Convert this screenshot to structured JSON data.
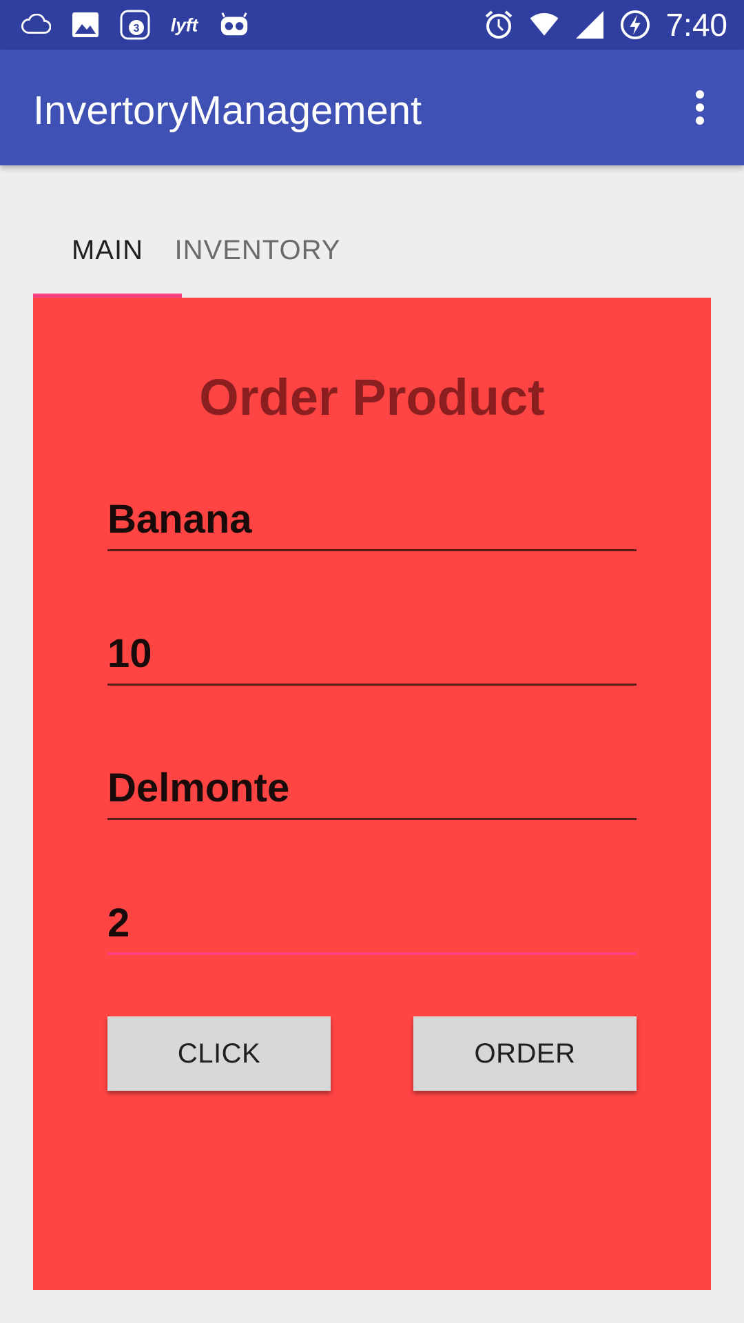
{
  "status_bar": {
    "time": "7:40",
    "icons": [
      "cloud-icon",
      "image-icon",
      "badge-3-icon",
      "lyft-icon",
      "robot-icon",
      "alarm-icon",
      "wifi-icon",
      "signal-icon",
      "battery-charging-icon"
    ],
    "badge_count": "3",
    "lyft_label": "lyft"
  },
  "app_bar": {
    "title": "InvertoryManagement",
    "menu_icon": "more-vert-icon"
  },
  "tabs": [
    {
      "label": "MAIN",
      "selected": true
    },
    {
      "label": "INVENTORY",
      "selected": false
    }
  ],
  "colors": {
    "status_bar": "#303f9f",
    "app_bar": "#3f51b5",
    "accent": "#ff4081",
    "panel": "#ff4444",
    "title_text": "#8b1f1f",
    "button": "#d6d7d7"
  },
  "form": {
    "title": "Order Product",
    "fields": [
      {
        "value": "Banana"
      },
      {
        "value": "10"
      },
      {
        "value": "Delmonte"
      },
      {
        "value": "2",
        "focused": true
      }
    ],
    "buttons": {
      "click_label": "CLICK",
      "order_label": "ORDER"
    }
  }
}
